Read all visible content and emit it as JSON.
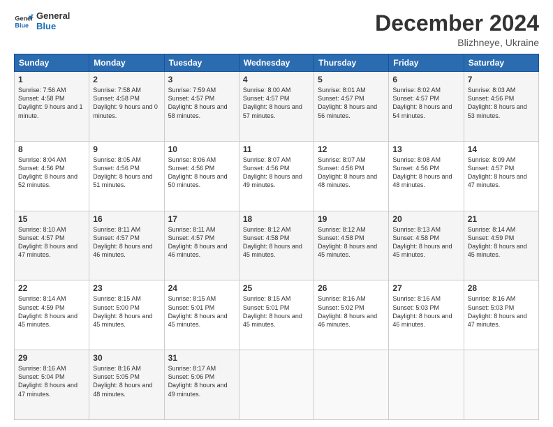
{
  "logo": {
    "line1": "General",
    "line2": "Blue"
  },
  "title": "December 2024",
  "subtitle": "Blizhneye, Ukraine",
  "header_days": [
    "Sunday",
    "Monday",
    "Tuesday",
    "Wednesday",
    "Thursday",
    "Friday",
    "Saturday"
  ],
  "weeks": [
    [
      {
        "day": "1",
        "sunrise": "Sunrise: 7:56 AM",
        "sunset": "Sunset: 4:58 PM",
        "daylight": "Daylight: 9 hours and 1 minute."
      },
      {
        "day": "2",
        "sunrise": "Sunrise: 7:58 AM",
        "sunset": "Sunset: 4:58 PM",
        "daylight": "Daylight: 9 hours and 0 minutes."
      },
      {
        "day": "3",
        "sunrise": "Sunrise: 7:59 AM",
        "sunset": "Sunset: 4:57 PM",
        "daylight": "Daylight: 8 hours and 58 minutes."
      },
      {
        "day": "4",
        "sunrise": "Sunrise: 8:00 AM",
        "sunset": "Sunset: 4:57 PM",
        "daylight": "Daylight: 8 hours and 57 minutes."
      },
      {
        "day": "5",
        "sunrise": "Sunrise: 8:01 AM",
        "sunset": "Sunset: 4:57 PM",
        "daylight": "Daylight: 8 hours and 56 minutes."
      },
      {
        "day": "6",
        "sunrise": "Sunrise: 8:02 AM",
        "sunset": "Sunset: 4:57 PM",
        "daylight": "Daylight: 8 hours and 54 minutes."
      },
      {
        "day": "7",
        "sunrise": "Sunrise: 8:03 AM",
        "sunset": "Sunset: 4:56 PM",
        "daylight": "Daylight: 8 hours and 53 minutes."
      }
    ],
    [
      {
        "day": "8",
        "sunrise": "Sunrise: 8:04 AM",
        "sunset": "Sunset: 4:56 PM",
        "daylight": "Daylight: 8 hours and 52 minutes."
      },
      {
        "day": "9",
        "sunrise": "Sunrise: 8:05 AM",
        "sunset": "Sunset: 4:56 PM",
        "daylight": "Daylight: 8 hours and 51 minutes."
      },
      {
        "day": "10",
        "sunrise": "Sunrise: 8:06 AM",
        "sunset": "Sunset: 4:56 PM",
        "daylight": "Daylight: 8 hours and 50 minutes."
      },
      {
        "day": "11",
        "sunrise": "Sunrise: 8:07 AM",
        "sunset": "Sunset: 4:56 PM",
        "daylight": "Daylight: 8 hours and 49 minutes."
      },
      {
        "day": "12",
        "sunrise": "Sunrise: 8:07 AM",
        "sunset": "Sunset: 4:56 PM",
        "daylight": "Daylight: 8 hours and 48 minutes."
      },
      {
        "day": "13",
        "sunrise": "Sunrise: 8:08 AM",
        "sunset": "Sunset: 4:56 PM",
        "daylight": "Daylight: 8 hours and 48 minutes."
      },
      {
        "day": "14",
        "sunrise": "Sunrise: 8:09 AM",
        "sunset": "Sunset: 4:57 PM",
        "daylight": "Daylight: 8 hours and 47 minutes."
      }
    ],
    [
      {
        "day": "15",
        "sunrise": "Sunrise: 8:10 AM",
        "sunset": "Sunset: 4:57 PM",
        "daylight": "Daylight: 8 hours and 47 minutes."
      },
      {
        "day": "16",
        "sunrise": "Sunrise: 8:11 AM",
        "sunset": "Sunset: 4:57 PM",
        "daylight": "Daylight: 8 hours and 46 minutes."
      },
      {
        "day": "17",
        "sunrise": "Sunrise: 8:11 AM",
        "sunset": "Sunset: 4:57 PM",
        "daylight": "Daylight: 8 hours and 46 minutes."
      },
      {
        "day": "18",
        "sunrise": "Sunrise: 8:12 AM",
        "sunset": "Sunset: 4:58 PM",
        "daylight": "Daylight: 8 hours and 45 minutes."
      },
      {
        "day": "19",
        "sunrise": "Sunrise: 8:12 AM",
        "sunset": "Sunset: 4:58 PM",
        "daylight": "Daylight: 8 hours and 45 minutes."
      },
      {
        "day": "20",
        "sunrise": "Sunrise: 8:13 AM",
        "sunset": "Sunset: 4:58 PM",
        "daylight": "Daylight: 8 hours and 45 minutes."
      },
      {
        "day": "21",
        "sunrise": "Sunrise: 8:14 AM",
        "sunset": "Sunset: 4:59 PM",
        "daylight": "Daylight: 8 hours and 45 minutes."
      }
    ],
    [
      {
        "day": "22",
        "sunrise": "Sunrise: 8:14 AM",
        "sunset": "Sunset: 4:59 PM",
        "daylight": "Daylight: 8 hours and 45 minutes."
      },
      {
        "day": "23",
        "sunrise": "Sunrise: 8:15 AM",
        "sunset": "Sunset: 5:00 PM",
        "daylight": "Daylight: 8 hours and 45 minutes."
      },
      {
        "day": "24",
        "sunrise": "Sunrise: 8:15 AM",
        "sunset": "Sunset: 5:01 PM",
        "daylight": "Daylight: 8 hours and 45 minutes."
      },
      {
        "day": "25",
        "sunrise": "Sunrise: 8:15 AM",
        "sunset": "Sunset: 5:01 PM",
        "daylight": "Daylight: 8 hours and 45 minutes."
      },
      {
        "day": "26",
        "sunrise": "Sunrise: 8:16 AM",
        "sunset": "Sunset: 5:02 PM",
        "daylight": "Daylight: 8 hours and 46 minutes."
      },
      {
        "day": "27",
        "sunrise": "Sunrise: 8:16 AM",
        "sunset": "Sunset: 5:03 PM",
        "daylight": "Daylight: 8 hours and 46 minutes."
      },
      {
        "day": "28",
        "sunrise": "Sunrise: 8:16 AM",
        "sunset": "Sunset: 5:03 PM",
        "daylight": "Daylight: 8 hours and 47 minutes."
      }
    ],
    [
      {
        "day": "29",
        "sunrise": "Sunrise: 8:16 AM",
        "sunset": "Sunset: 5:04 PM",
        "daylight": "Daylight: 8 hours and 47 minutes."
      },
      {
        "day": "30",
        "sunrise": "Sunrise: 8:16 AM",
        "sunset": "Sunset: 5:05 PM",
        "daylight": "Daylight: 8 hours and 48 minutes."
      },
      {
        "day": "31",
        "sunrise": "Sunrise: 8:17 AM",
        "sunset": "Sunset: 5:06 PM",
        "daylight": "Daylight: 8 hours and 49 minutes."
      },
      null,
      null,
      null,
      null
    ]
  ]
}
